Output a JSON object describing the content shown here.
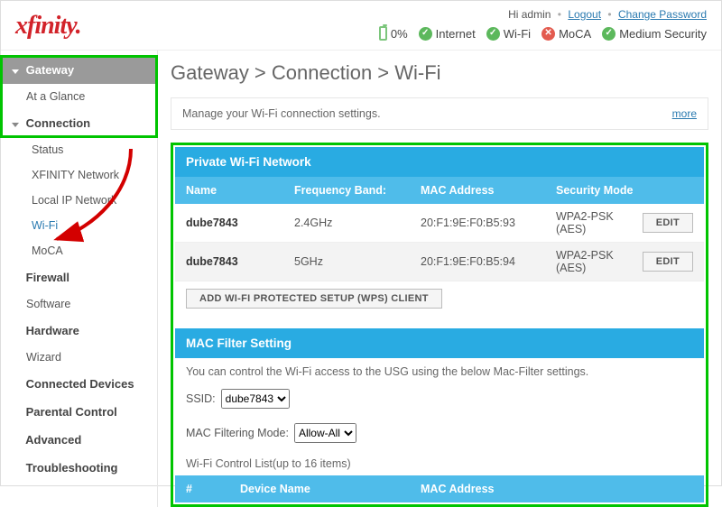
{
  "header": {
    "logo": "xfinity.",
    "greeting": "Hi admin",
    "logout": "Logout",
    "change_pw": "Change Password",
    "battery_pct": "0%",
    "status": {
      "internet": "Internet",
      "wifi": "Wi-Fi",
      "moca": "MoCA",
      "security": "Medium Security"
    }
  },
  "sidebar": {
    "gateway": "Gateway",
    "at_a_glance": "At a Glance",
    "connection": "Connection",
    "status": "Status",
    "xfinity_net": "XFINITY Network",
    "local_ip": "Local IP Network",
    "wifi": "Wi-Fi",
    "moca": "MoCA",
    "firewall": "Firewall",
    "software": "Software",
    "hardware": "Hardware",
    "wizard": "Wizard",
    "connected": "Connected Devices",
    "parental": "Parental Control",
    "advanced": "Advanced",
    "troubleshooting": "Troubleshooting"
  },
  "main": {
    "breadcrumb": "Gateway > Connection > Wi-Fi",
    "help_text": "Manage your Wi-Fi connection settings.",
    "more": "more",
    "private_title": "Private Wi-Fi Network",
    "cols": {
      "name": "Name",
      "freq": "Frequency Band:",
      "mac": "MAC Address",
      "sec": "Security Mode"
    },
    "rows": [
      {
        "name": "dube7843",
        "freq": "2.4GHz",
        "mac": "20:F1:9E:F0:B5:93",
        "sec": "WPA2-PSK (AES)",
        "edit": "EDIT"
      },
      {
        "name": "dube7843",
        "freq": "5GHz",
        "mac": "20:F1:9E:F0:B5:94",
        "sec": "WPA2-PSK (AES)",
        "edit": "EDIT"
      }
    ],
    "add_wps": "ADD WI-FI PROTECTED SETUP (WPS) CLIENT",
    "macfilter_title": "MAC Filter Setting",
    "macfilter_desc": "You can control the Wi-Fi access to the USG using the below Mac-Filter settings.",
    "ssid_label": "SSID:",
    "ssid_value": "dube7843",
    "mode_label": "MAC Filtering Mode:",
    "mode_value": "Allow-All",
    "control_list_label": "Wi-Fi Control List(up to 16 items)",
    "list_cols": {
      "num": "#",
      "device": "Device Name",
      "mac": "MAC Address"
    }
  }
}
